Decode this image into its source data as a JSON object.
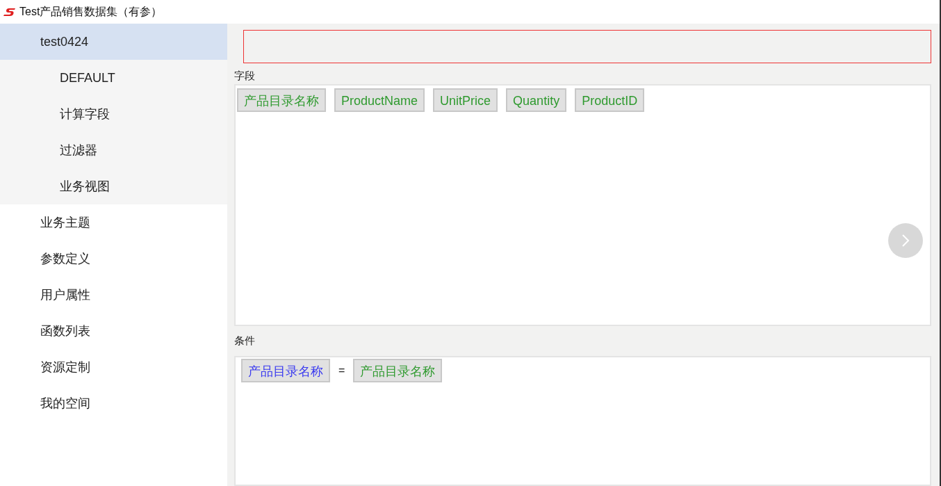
{
  "window": {
    "title": "Test产品销售数据集（有参）"
  },
  "sidebar": {
    "items": [
      {
        "label": "test0424",
        "selected": true,
        "children": [
          {
            "label": "DEFAULT",
            "selected": false
          },
          {
            "label": "计算字段",
            "selected": false
          },
          {
            "label": "过滤器",
            "selected": false
          },
          {
            "label": "业务视图",
            "selected": false
          }
        ]
      },
      {
        "label": "业务主题",
        "selected": false
      },
      {
        "label": "参数定义",
        "selected": false
      },
      {
        "label": "用户属性",
        "selected": false
      },
      {
        "label": "函数列表",
        "selected": false
      },
      {
        "label": "资源定制",
        "selected": false
      },
      {
        "label": "我的空间",
        "selected": false
      }
    ]
  },
  "fields": {
    "label": "字段",
    "chips": [
      {
        "label": "产品目录名称",
        "kind": "field"
      },
      {
        "label": "ProductName",
        "kind": "field"
      },
      {
        "label": "UnitPrice",
        "kind": "field"
      },
      {
        "label": "Quantity",
        "kind": "field"
      },
      {
        "label": "ProductID",
        "kind": "field"
      }
    ]
  },
  "conditions": {
    "label": "条件",
    "items": [
      {
        "label": "产品目录名称",
        "kind": "parameter"
      },
      {
        "label": "=",
        "kind": "operator"
      },
      {
        "label": "产品目录名称",
        "kind": "field"
      }
    ]
  }
}
